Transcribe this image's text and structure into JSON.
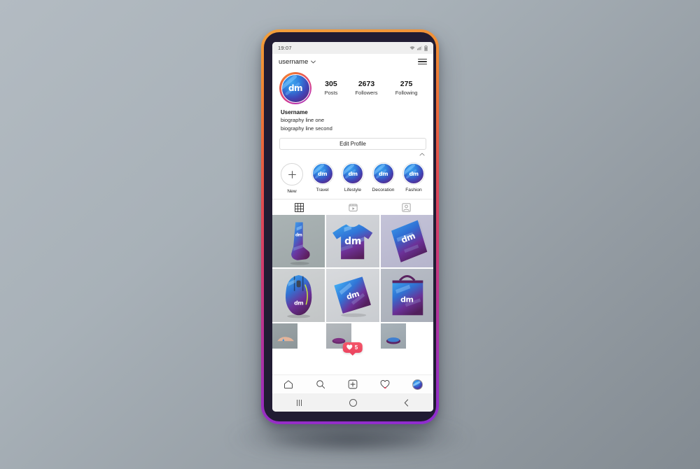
{
  "status_bar": {
    "time": "19:07",
    "icons": [
      "wifi-icon",
      "signal-icon",
      "battery-icon"
    ]
  },
  "app_header": {
    "username": "username",
    "chevron": "chevron-down-icon",
    "menu": "hamburger-menu-icon"
  },
  "profile": {
    "avatar_logo": "dm",
    "stats": [
      {
        "value": "305",
        "label": "Posts"
      },
      {
        "value": "2673",
        "label": "Followers"
      },
      {
        "value": "275",
        "label": "Following"
      }
    ],
    "display_name": "Username",
    "bio_lines": [
      "biography line one",
      "biography line second"
    ],
    "edit_button": "Edit Profile",
    "collapse_icon": "chevron-up-icon"
  },
  "highlights": [
    {
      "label": "New",
      "type": "add",
      "logo": ""
    },
    {
      "label": "Travel",
      "type": "cover",
      "logo": "dm"
    },
    {
      "label": "Lifestyle",
      "type": "cover",
      "logo": "dm"
    },
    {
      "label": "Decoration",
      "type": "cover",
      "logo": "dm"
    },
    {
      "label": "Fashion",
      "type": "cover",
      "logo": "dm"
    }
  ],
  "tabs": [
    {
      "name": "grid-tab",
      "icon": "grid-icon",
      "active": true
    },
    {
      "name": "reels-tab",
      "icon": "reels-icon",
      "active": false
    },
    {
      "name": "tagged-tab",
      "icon": "tagged-icon",
      "active": false
    }
  ],
  "grid": {
    "row1": [
      {
        "name": "post-sock",
        "logo": "dm"
      },
      {
        "name": "post-tshirt",
        "logo": "dm"
      },
      {
        "name": "post-book",
        "logo": "dm"
      }
    ],
    "row2": [
      {
        "name": "post-mouse",
        "logo": "dm"
      },
      {
        "name": "post-card",
        "logo": "dm"
      },
      {
        "name": "post-bag",
        "logo": "dm"
      }
    ],
    "row3": [
      {
        "name": "post-hand",
        "logo": ""
      },
      {
        "name": "post-cap",
        "logo": ""
      },
      {
        "name": "post-cap2",
        "logo": ""
      }
    ]
  },
  "like_badge": {
    "count": "5",
    "icon": "heart-icon",
    "color": "#ec4560"
  },
  "app_nav": [
    {
      "name": "nav-home",
      "icon": "home-icon",
      "badge_dot": false
    },
    {
      "name": "nav-search",
      "icon": "search-icon",
      "badge_dot": false
    },
    {
      "name": "nav-create",
      "icon": "plus-box-icon",
      "badge_dot": false
    },
    {
      "name": "nav-activity",
      "icon": "heart-icon",
      "badge_dot": true
    },
    {
      "name": "nav-profile",
      "icon": "avatar-icon",
      "badge_dot": false
    }
  ],
  "system_nav": [
    {
      "name": "sys-recents",
      "icon": "recents-icon"
    },
    {
      "name": "sys-home",
      "icon": "home-circle-icon"
    },
    {
      "name": "sys-back",
      "icon": "back-chevron-icon"
    }
  ],
  "theme": {
    "frame_gradient_start": "#f2a03c",
    "frame_gradient_end": "#8e2dd0",
    "page_bg_light": "#b3bbc2",
    "page_bg_dark": "#838b92",
    "brand_blue": "#2f7fdc",
    "brand_purple": "#5a2a86",
    "accent_red": "#ec4560"
  }
}
